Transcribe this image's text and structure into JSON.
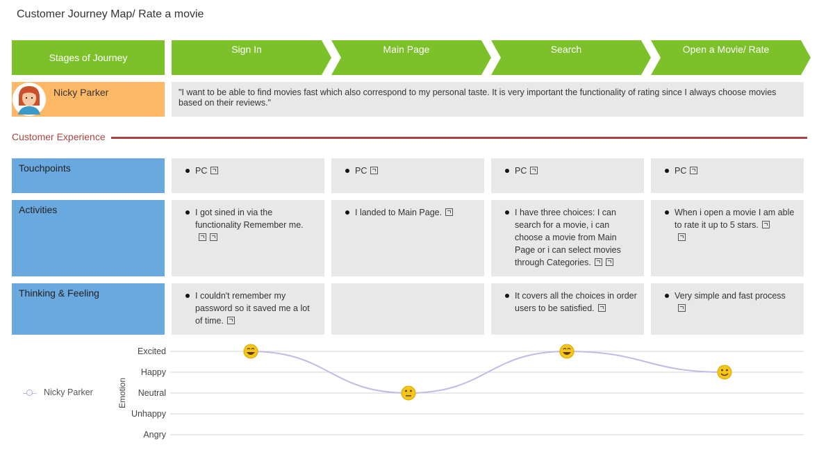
{
  "title": "Customer Journey Map/ Rate a movie",
  "stages_header": "Stages of Journey",
  "stages": [
    "Sign In",
    "Main Page",
    "Search",
    "Open a Movie/ Rate"
  ],
  "persona": {
    "name": "Nicky Parker",
    "quote": "\"I want to be able to find movies fast which also correspond to my personal taste. It is very important the functionality of rating since I always choose movies based on their reviews.\""
  },
  "section_label": "Customer Experience",
  "rows": {
    "touchpoints": {
      "label": "Touchpoints",
      "cells": [
        "PC",
        "PC",
        "PC",
        "PC"
      ]
    },
    "activities": {
      "label": "Activities",
      "cells": [
        "I got sined in via the functionality Remember me.",
        "I landed to Main Page.",
        "I have three choices: I can search for a movie, i can choose a movie from Main Page or i can select movies through Categories.",
        "When i open a movie I am able to rate it up to 5 stars."
      ]
    },
    "thinking": {
      "label": "Thinking & Feeling",
      "cells": [
        "I couldn't remember my password so it saved me a lot of time.",
        "",
        "It covers all the choices in order users to be satisfied.",
        "Very simple and fast process"
      ]
    }
  },
  "colors": {
    "stage_green": "#7dc12a",
    "persona_orange": "#ffb966",
    "row_blue": "#6aa8e0",
    "cell_gray": "#e8e8e8",
    "accent_red": "#a94442",
    "curve": "#c3b8e8"
  },
  "chart_data": {
    "type": "line",
    "ylabel": "Emotion",
    "y_levels": [
      "Excited",
      "Happy",
      "Neutral",
      "Unhappy",
      "Angry"
    ],
    "categories": [
      "Sign In",
      "Main Page",
      "Search",
      "Open a Movie/ Rate"
    ],
    "series": [
      {
        "name": "Nicky Parker",
        "values": [
          "Excited",
          "Neutral",
          "Excited",
          "Happy"
        ]
      }
    ],
    "legend": "left"
  }
}
